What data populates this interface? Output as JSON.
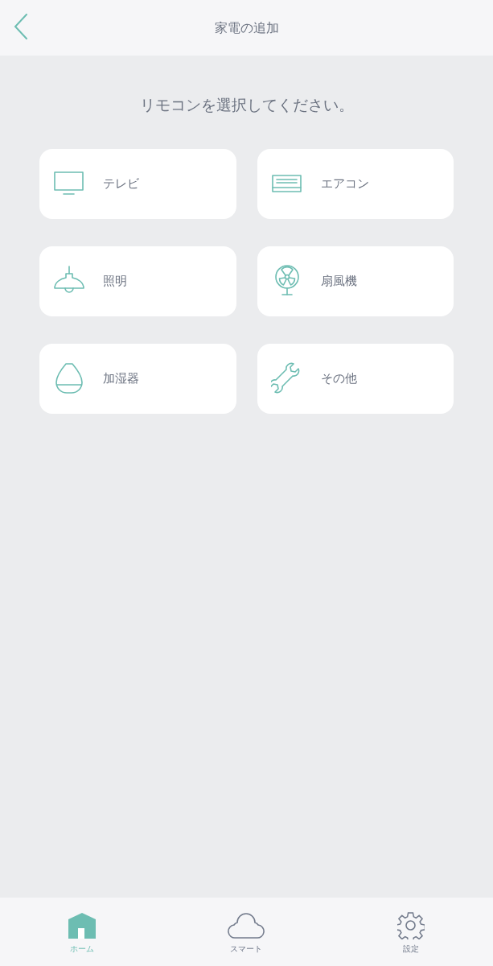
{
  "header": {
    "title": "家電の追加"
  },
  "prompt": "リモコンを選択してください。",
  "devices": [
    {
      "kind": "tv",
      "label": "テレビ"
    },
    {
      "kind": "aircon",
      "label": "エアコン"
    },
    {
      "kind": "light",
      "label": "照明"
    },
    {
      "kind": "fan",
      "label": "扇風機"
    },
    {
      "kind": "humidifier",
      "label": "加湿器"
    },
    {
      "kind": "other",
      "label": "その他"
    }
  ],
  "tabs": [
    {
      "kind": "home",
      "label": "ホーム",
      "selected": true
    },
    {
      "kind": "cloud",
      "label": "スマート",
      "selected": false
    },
    {
      "kind": "settings",
      "label": "設定",
      "selected": false
    }
  ]
}
